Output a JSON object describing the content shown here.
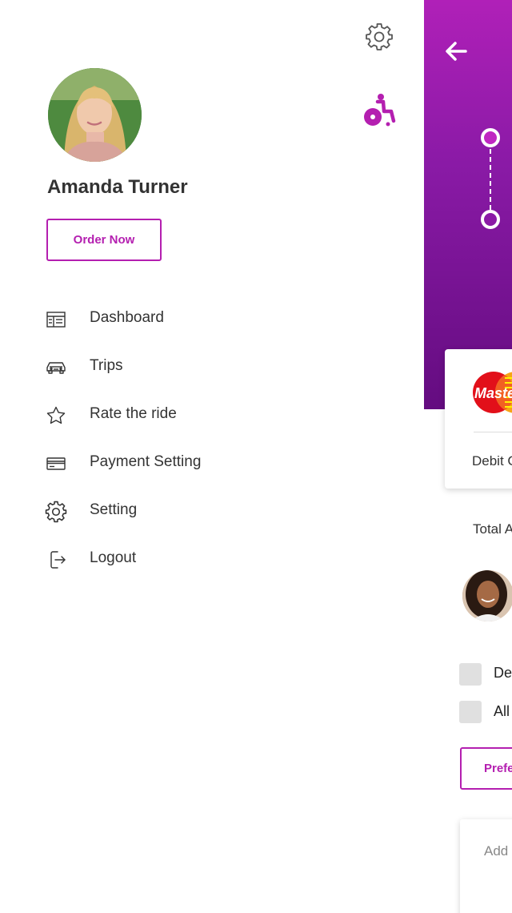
{
  "drawer": {
    "user_name": "Amanda Turner",
    "order_button": "Order Now",
    "menu": [
      {
        "label": "Dashboard",
        "icon": "dashboard-icon"
      },
      {
        "label": "Trips",
        "icon": "car-icon"
      },
      {
        "label": "Rate the ride",
        "icon": "star-icon"
      },
      {
        "label": "Payment Setting",
        "icon": "credit-card-icon"
      },
      {
        "label": "Setting",
        "icon": "gear-icon"
      },
      {
        "label": "Logout",
        "icon": "logout-icon"
      }
    ],
    "icons": {
      "settings": "gear-icon",
      "accessibility": "wheelchair-icon"
    }
  },
  "background_screen": {
    "card_brand": "Maste",
    "card_type": "Debit C",
    "total_label": "Total A",
    "options": [
      {
        "label": "De"
      },
      {
        "label": "All"
      }
    ],
    "preference_button": "Prefe",
    "note_placeholder": "Add"
  },
  "colors": {
    "accent": "#b41fb0",
    "header_gradient_top": "#b020b8",
    "header_gradient_bottom": "#640c80",
    "text": "#333333"
  }
}
